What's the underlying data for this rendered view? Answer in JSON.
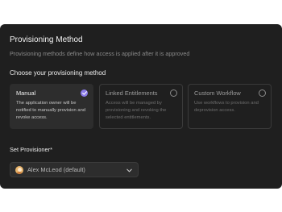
{
  "header": {
    "title": "Provisioning Method",
    "subtitle": "Provisioning methods define how access is applied after it is approved"
  },
  "method_section": {
    "label": "Choose your provisioning method",
    "options": [
      {
        "title": "Manual",
        "description": "The application owner will be notified to manually provision and revoke access.",
        "selected": true
      },
      {
        "title": "Linked Entitlements",
        "description": "Access will be managed by provisioning and revoking the selected entitlements.",
        "selected": false
      },
      {
        "title": "Custom Workflow",
        "description": "Use workflows to provision and deprovision access.",
        "selected": false
      }
    ]
  },
  "provisioner": {
    "label": "Set Provisioner*",
    "value": "Alex McLeod (default)",
    "avatar_icon": "user-avatar",
    "dropdown_icon": "chevron-down-icon"
  },
  "colors": {
    "panel_bg": "#1f1f1f",
    "selected_card_bg": "#2d2d2d",
    "accent": "#8b7be8"
  }
}
